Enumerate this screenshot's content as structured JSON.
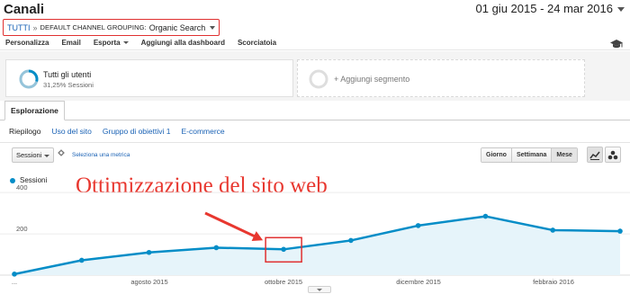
{
  "header": {
    "title": "Canali",
    "date_range": "01 giu 2015 - 24 mar 2016"
  },
  "breadcrumb": {
    "all_label": "TUTTI",
    "separator": "»",
    "dimension_label": "DEFAULT CHANNEL GROUPING:",
    "dimension_value": "Organic Search"
  },
  "toolbar": {
    "items": [
      "Personalizza",
      "Email",
      "Esporta",
      "Aggiungi alla dashboard",
      "Scorciatoia"
    ]
  },
  "segments": {
    "active": {
      "name": "Tutti gli utenti",
      "share": "31,25% Sessioni"
    },
    "add_label": "+ Aggiungi segmento"
  },
  "tabs": {
    "active": "Esplorazione"
  },
  "subnav": [
    "Riepilogo",
    "Uso del sito",
    "Gruppo di obiettivi 1",
    "E-commerce"
  ],
  "controls": {
    "metric_select": "Sessioni",
    "vs_label": "▾",
    "add_metric": "Seleziona una metrica",
    "periods": [
      "Giorno",
      "Settimana",
      "Mese"
    ],
    "active_period": "Mese"
  },
  "colors": {
    "series": "#058dc7",
    "area": "#e6f4fa",
    "highlight": "#e03030",
    "annotation": "#e8372f"
  },
  "annotation": "Ottimizzazione del sito web",
  "chart_data": {
    "type": "line",
    "x_tick_labels": [
      "...",
      "agosto 2015",
      "ottobre 2015",
      "dicembre 2015",
      "febbraio 2016"
    ],
    "series": [
      {
        "name": "Sessioni",
        "x": [
          "giu 2015",
          "lug 2015",
          "ago 2015",
          "set 2015",
          "ott 2015",
          "nov 2015",
          "dic 2015",
          "gen 2016",
          "feb 2016",
          "mar 2016"
        ],
        "values": [
          5,
          72,
          110,
          133,
          125,
          168,
          240,
          285,
          218,
          213
        ]
      }
    ],
    "y_ticks": [
      200,
      400
    ],
    "ylim": [
      0,
      440
    ],
    "highlight_index": 4,
    "grid": true
  }
}
